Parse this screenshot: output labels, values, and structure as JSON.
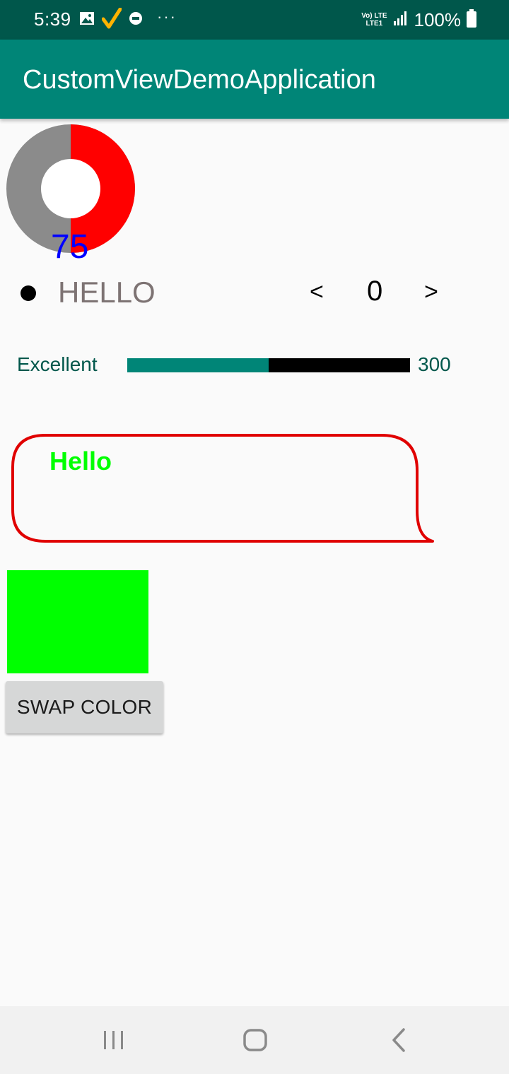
{
  "status_bar": {
    "time": "5:39",
    "left_icons": [
      "image-icon",
      "check-icon",
      "jio-icon",
      "more-dots-icon"
    ],
    "more_dots": "···",
    "network_label_top": "Vo) LTE",
    "network_label_bottom": "LTE1",
    "battery_text": "100%"
  },
  "app_bar": {
    "title": "CustomViewDemoApplication"
  },
  "donut": {
    "value": "75",
    "fraction": 0.5,
    "colors": {
      "track": "#8b8b8b",
      "fill": "#ff0000",
      "center": "#ffffff",
      "value_text": "#0000ff"
    }
  },
  "hello_row": {
    "text": "HELLO",
    "stepper": {
      "prev": "<",
      "value": "0",
      "next": ">"
    }
  },
  "rating": {
    "label": "Excellent",
    "value": "300",
    "progress_fraction": 0.5,
    "colors": {
      "fill": "#008577",
      "track": "#000000"
    }
  },
  "bubble": {
    "text": "Hello",
    "colors": {
      "stroke": "#e00000",
      "text": "#00ff00"
    }
  },
  "swatch": {
    "color": "#00ff00"
  },
  "swap_button": {
    "label": "SWAP COLOR"
  },
  "nav_bar": {
    "items": [
      "recent-apps-icon",
      "home-icon",
      "back-icon"
    ]
  },
  "colors": {
    "status_bar": "#00574b",
    "app_bar": "#008577",
    "background": "#fafafa"
  }
}
